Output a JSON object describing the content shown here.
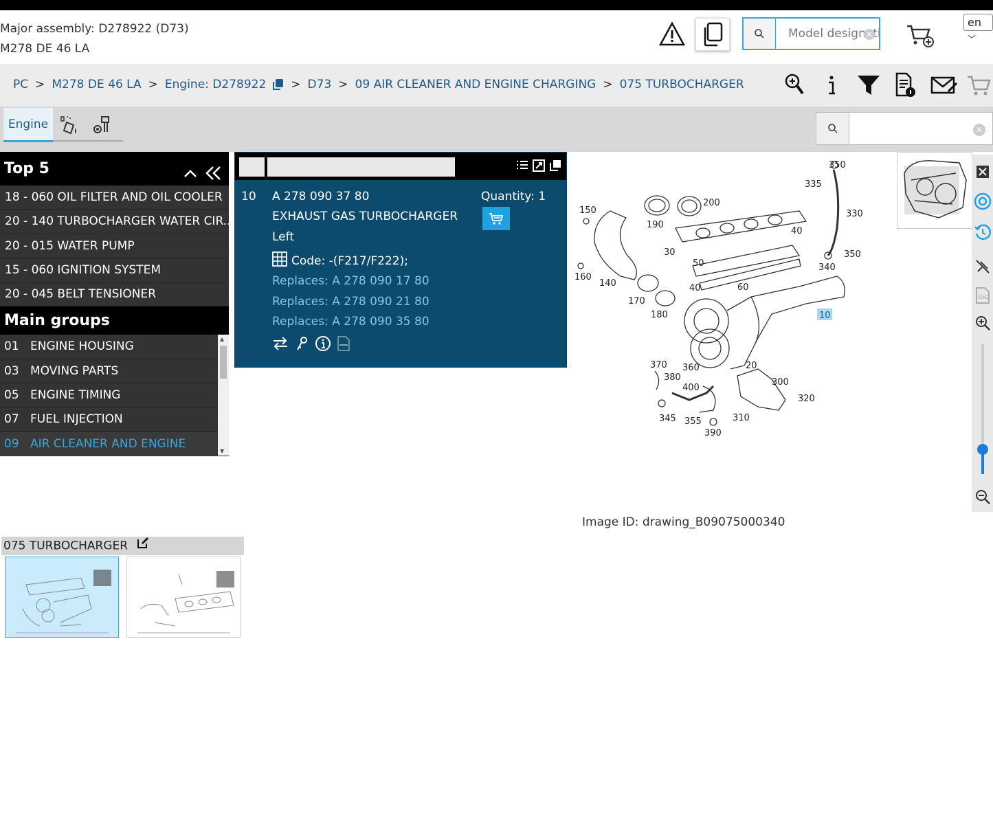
{
  "header": {
    "major_assembly": "Major assembly: D278922 (D73)",
    "engine": "M278 DE 46 LA",
    "model_search_placeholder": "Model designation",
    "language": "en"
  },
  "breadcrumb": {
    "items": [
      "PC",
      "M278 DE 46 LA",
      "Engine: D278922",
      "D73",
      "09 AIR CLEANER AND ENGINE CHARGING",
      "075 TURBOCHARGER"
    ],
    "separator": ">"
  },
  "tabs": {
    "engine_label": "Engine"
  },
  "top5": {
    "title": "Top 5",
    "items": [
      "18 - 060 OIL FILTER AND OIL COOLER",
      "20 - 140 TURBOCHARGER WATER CIR...",
      "20 - 015 WATER PUMP",
      "15 - 060 IGNITION SYSTEM",
      "20 - 045 BELT TENSIONER"
    ]
  },
  "main_groups": {
    "title": "Main groups",
    "items": [
      {
        "num": "01",
        "label": "ENGINE HOUSING"
      },
      {
        "num": "03",
        "label": "MOVING PARTS"
      },
      {
        "num": "05",
        "label": "ENGINE TIMING"
      },
      {
        "num": "07",
        "label": "FUEL INJECTION"
      },
      {
        "num": "09",
        "label": "AIR CLEANER AND ENGINE"
      }
    ]
  },
  "part": {
    "position": "10",
    "number": "A 278 090 37 80",
    "name": "EXHAUST GAS TURBOCHARGER",
    "side": "Left",
    "code": "Code: -(F217/F222);",
    "quantity": "Quantity: 1",
    "replaces": [
      "Replaces: A 278 090 17 80",
      "Replaces: A 278 090 21 80",
      "Replaces: A 278 090 35 80"
    ]
  },
  "drawing": {
    "labels": [
      "350",
      "335",
      "330",
      "200",
      "150",
      "190",
      "40",
      "30",
      "350",
      "50",
      "340",
      "160",
      "140",
      "40",
      "60",
      "10",
      "170",
      "180",
      "370",
      "360",
      "20",
      "380",
      "400",
      "300",
      "320",
      "345",
      "355",
      "310",
      "390"
    ],
    "highlighted": "10",
    "image_id": "Image ID: drawing_B09075000340"
  },
  "gallery": {
    "title": "075 TURBOCHARGER"
  },
  "colors": {
    "accent": "#3aa6d8",
    "panel": "#0c4a6e",
    "cart": "#1fa3e0"
  }
}
